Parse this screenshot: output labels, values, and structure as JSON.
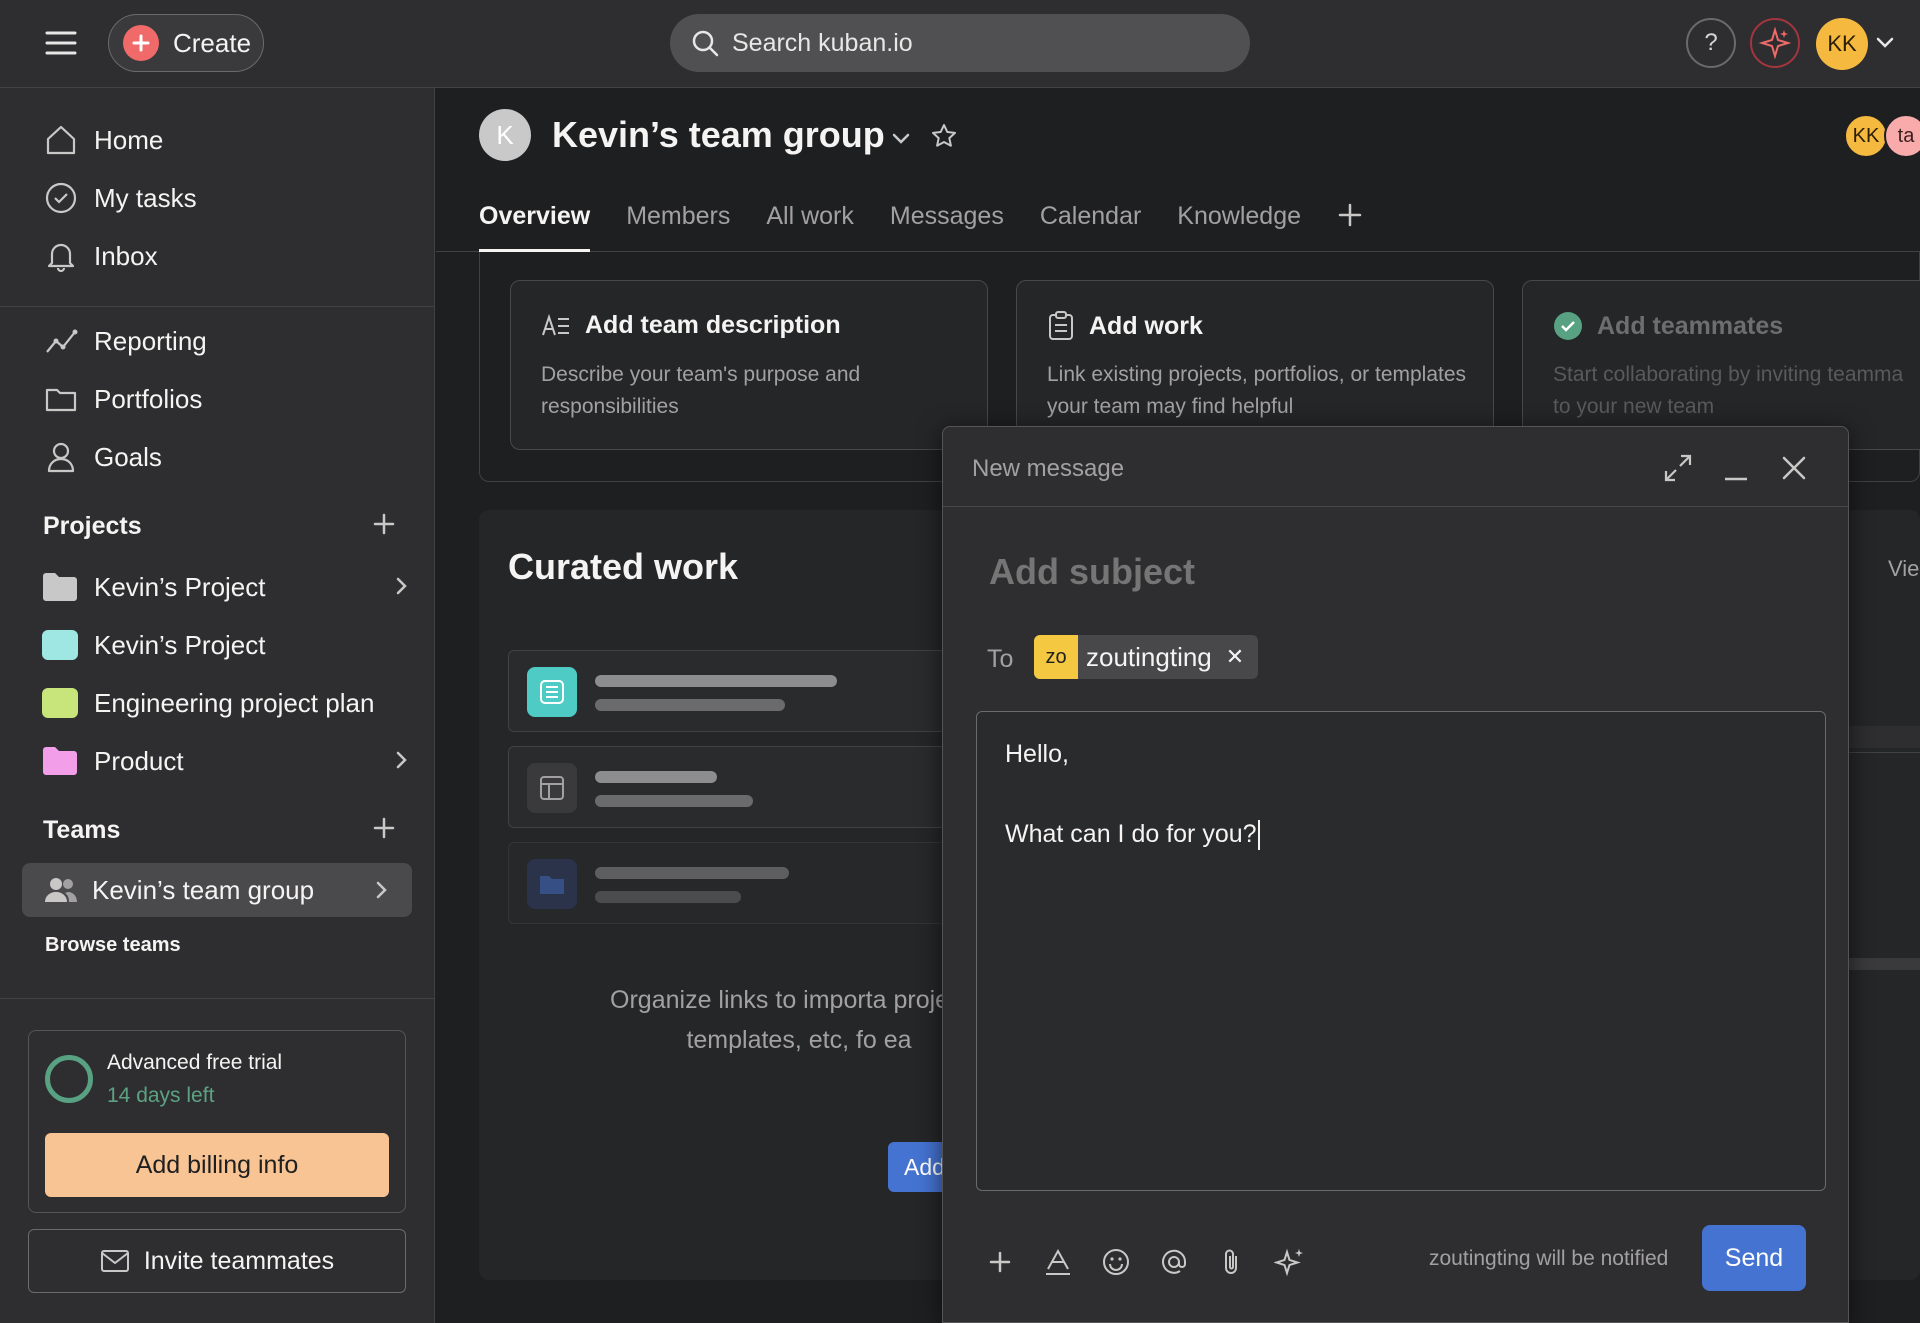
{
  "topbar": {
    "create_label": "Create",
    "search_placeholder": "Search kuban.io",
    "help_label": "?",
    "user_initials": "KK"
  },
  "sidebar": {
    "nav": [
      {
        "label": "Home",
        "icon": "home-icon"
      },
      {
        "label": "My tasks",
        "icon": "check-circle-icon"
      },
      {
        "label": "Inbox",
        "icon": "bell-icon"
      }
    ],
    "insights": [
      {
        "label": "Reporting",
        "icon": "chart-line-icon"
      },
      {
        "label": "Portfolios",
        "icon": "folder-icon"
      },
      {
        "label": "Goals",
        "icon": "person-icon"
      }
    ],
    "projects_title": "Projects",
    "projects": [
      {
        "label": "Kevin’s Project",
        "color": "#c8c8c9",
        "type": "folder"
      },
      {
        "label": "Kevin’s Project",
        "color": "#9ee7e3",
        "type": "square"
      },
      {
        "label": "Engineering project plan",
        "color": "#c7e57a",
        "type": "square"
      },
      {
        "label": "Product",
        "color": "#f29ee8",
        "type": "folder"
      }
    ],
    "teams_title": "Teams",
    "team_active": "Kevin’s team group",
    "browse_teams": "Browse teams",
    "trial_title": "Advanced free trial",
    "trial_days": "14 days left",
    "billing_label": "Add billing info",
    "invite_label": "Invite teammates"
  },
  "main": {
    "team_initial": "K",
    "title": "Kevin’s team group",
    "members": [
      {
        "initials": "KK",
        "color": "#f5b940"
      },
      {
        "initials": "ta",
        "color": "#f9aaaa"
      }
    ],
    "tabs": [
      "Overview",
      "Members",
      "All work",
      "Messages",
      "Calendar",
      "Knowledge"
    ],
    "active_tab": "Overview",
    "cards": [
      {
        "title": "Add team description",
        "desc": "Describe your team's purpose and responsibilities"
      },
      {
        "title": "Add work",
        "desc": "Link existing projects, portfolios, or templates your team may find helpful"
      },
      {
        "title": "Add teammates",
        "desc": "Start collaborating by inviting teamma to your new team"
      }
    ],
    "curated_title": "Curated work",
    "curated_text": "Organize links to importa projects, templates, etc, fo ea",
    "curated_btn": "Add",
    "right_view": "Vie"
  },
  "composer": {
    "title": "New message",
    "subject_placeholder": "Add subject",
    "to_label": "To",
    "recipient_initials": "zo",
    "recipient_name": "zoutingting",
    "body_line1": "Hello,",
    "body_line2": "What can I do for you?",
    "notify_text": "zoutingting will be notified",
    "send_label": "Send"
  }
}
